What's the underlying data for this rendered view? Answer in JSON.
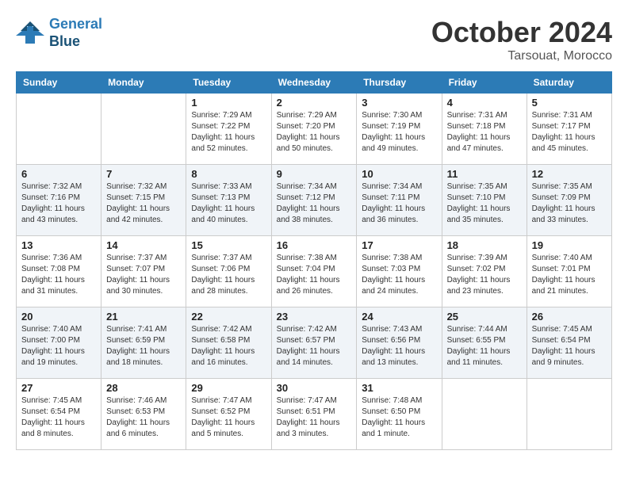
{
  "header": {
    "logo_line1": "General",
    "logo_line2": "Blue",
    "month": "October 2024",
    "location": "Tarsouat, Morocco"
  },
  "weekdays": [
    "Sunday",
    "Monday",
    "Tuesday",
    "Wednesday",
    "Thursday",
    "Friday",
    "Saturday"
  ],
  "weeks": [
    [
      {
        "day": "",
        "info": ""
      },
      {
        "day": "",
        "info": ""
      },
      {
        "day": "1",
        "info": "Sunrise: 7:29 AM\nSunset: 7:22 PM\nDaylight: 11 hours and 52 minutes."
      },
      {
        "day": "2",
        "info": "Sunrise: 7:29 AM\nSunset: 7:20 PM\nDaylight: 11 hours and 50 minutes."
      },
      {
        "day": "3",
        "info": "Sunrise: 7:30 AM\nSunset: 7:19 PM\nDaylight: 11 hours and 49 minutes."
      },
      {
        "day": "4",
        "info": "Sunrise: 7:31 AM\nSunset: 7:18 PM\nDaylight: 11 hours and 47 minutes."
      },
      {
        "day": "5",
        "info": "Sunrise: 7:31 AM\nSunset: 7:17 PM\nDaylight: 11 hours and 45 minutes."
      }
    ],
    [
      {
        "day": "6",
        "info": "Sunrise: 7:32 AM\nSunset: 7:16 PM\nDaylight: 11 hours and 43 minutes."
      },
      {
        "day": "7",
        "info": "Sunrise: 7:32 AM\nSunset: 7:15 PM\nDaylight: 11 hours and 42 minutes."
      },
      {
        "day": "8",
        "info": "Sunrise: 7:33 AM\nSunset: 7:13 PM\nDaylight: 11 hours and 40 minutes."
      },
      {
        "day": "9",
        "info": "Sunrise: 7:34 AM\nSunset: 7:12 PM\nDaylight: 11 hours and 38 minutes."
      },
      {
        "day": "10",
        "info": "Sunrise: 7:34 AM\nSunset: 7:11 PM\nDaylight: 11 hours and 36 minutes."
      },
      {
        "day": "11",
        "info": "Sunrise: 7:35 AM\nSunset: 7:10 PM\nDaylight: 11 hours and 35 minutes."
      },
      {
        "day": "12",
        "info": "Sunrise: 7:35 AM\nSunset: 7:09 PM\nDaylight: 11 hours and 33 minutes."
      }
    ],
    [
      {
        "day": "13",
        "info": "Sunrise: 7:36 AM\nSunset: 7:08 PM\nDaylight: 11 hours and 31 minutes."
      },
      {
        "day": "14",
        "info": "Sunrise: 7:37 AM\nSunset: 7:07 PM\nDaylight: 11 hours and 30 minutes."
      },
      {
        "day": "15",
        "info": "Sunrise: 7:37 AM\nSunset: 7:06 PM\nDaylight: 11 hours and 28 minutes."
      },
      {
        "day": "16",
        "info": "Sunrise: 7:38 AM\nSunset: 7:04 PM\nDaylight: 11 hours and 26 minutes."
      },
      {
        "day": "17",
        "info": "Sunrise: 7:38 AM\nSunset: 7:03 PM\nDaylight: 11 hours and 24 minutes."
      },
      {
        "day": "18",
        "info": "Sunrise: 7:39 AM\nSunset: 7:02 PM\nDaylight: 11 hours and 23 minutes."
      },
      {
        "day": "19",
        "info": "Sunrise: 7:40 AM\nSunset: 7:01 PM\nDaylight: 11 hours and 21 minutes."
      }
    ],
    [
      {
        "day": "20",
        "info": "Sunrise: 7:40 AM\nSunset: 7:00 PM\nDaylight: 11 hours and 19 minutes."
      },
      {
        "day": "21",
        "info": "Sunrise: 7:41 AM\nSunset: 6:59 PM\nDaylight: 11 hours and 18 minutes."
      },
      {
        "day": "22",
        "info": "Sunrise: 7:42 AM\nSunset: 6:58 PM\nDaylight: 11 hours and 16 minutes."
      },
      {
        "day": "23",
        "info": "Sunrise: 7:42 AM\nSunset: 6:57 PM\nDaylight: 11 hours and 14 minutes."
      },
      {
        "day": "24",
        "info": "Sunrise: 7:43 AM\nSunset: 6:56 PM\nDaylight: 11 hours and 13 minutes."
      },
      {
        "day": "25",
        "info": "Sunrise: 7:44 AM\nSunset: 6:55 PM\nDaylight: 11 hours and 11 minutes."
      },
      {
        "day": "26",
        "info": "Sunrise: 7:45 AM\nSunset: 6:54 PM\nDaylight: 11 hours and 9 minutes."
      }
    ],
    [
      {
        "day": "27",
        "info": "Sunrise: 7:45 AM\nSunset: 6:54 PM\nDaylight: 11 hours and 8 minutes."
      },
      {
        "day": "28",
        "info": "Sunrise: 7:46 AM\nSunset: 6:53 PM\nDaylight: 11 hours and 6 minutes."
      },
      {
        "day": "29",
        "info": "Sunrise: 7:47 AM\nSunset: 6:52 PM\nDaylight: 11 hours and 5 minutes."
      },
      {
        "day": "30",
        "info": "Sunrise: 7:47 AM\nSunset: 6:51 PM\nDaylight: 11 hours and 3 minutes."
      },
      {
        "day": "31",
        "info": "Sunrise: 7:48 AM\nSunset: 6:50 PM\nDaylight: 11 hours and 1 minute."
      },
      {
        "day": "",
        "info": ""
      },
      {
        "day": "",
        "info": ""
      }
    ]
  ]
}
